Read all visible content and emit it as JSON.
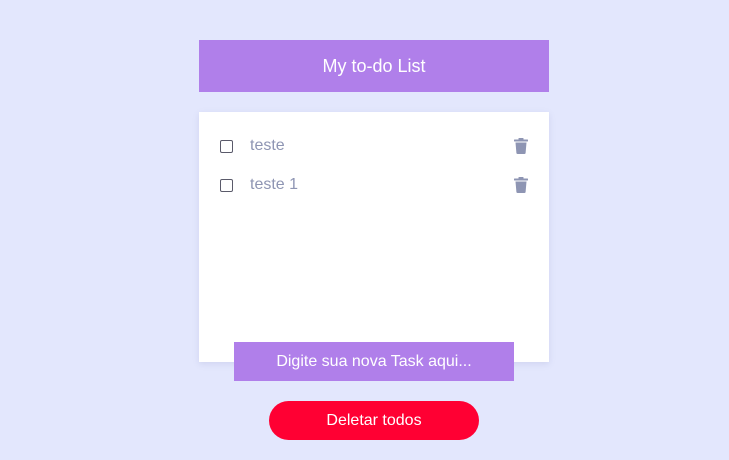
{
  "header": {
    "title": "My to-do List"
  },
  "tasks": [
    {
      "label": "teste",
      "checked": false,
      "delete_icon": "trash-icon"
    },
    {
      "label": "teste 1",
      "checked": false,
      "delete_icon": "trash-icon"
    }
  ],
  "new_task": {
    "placeholder": "Digite sua nova Task aqui..."
  },
  "actions": {
    "delete_all_label": "Deletar todos"
  },
  "colors": {
    "background": "#e3e7fd",
    "accent": "#b07fea",
    "danger": "#ff0033",
    "task_text": "#8e95b3",
    "icon": "#8e95b3"
  }
}
